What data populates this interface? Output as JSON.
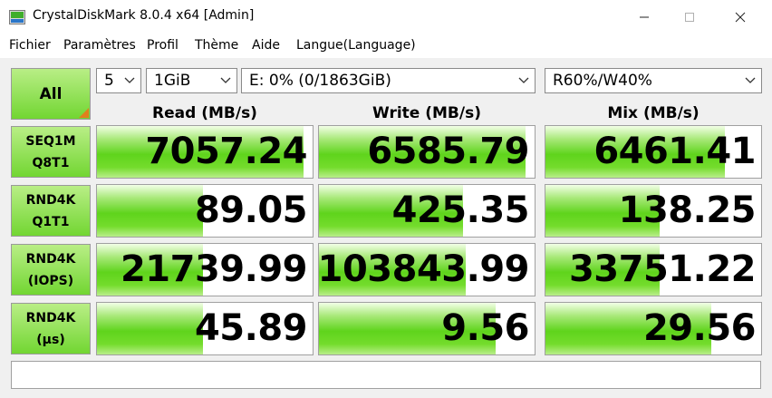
{
  "window": {
    "title": "CrystalDiskMark 8.0.4 x64 [Admin]",
    "controls": {
      "minimize": "minimize-icon",
      "maximize": "maximize-icon",
      "close": "close-icon"
    }
  },
  "menu": [
    "Fichier",
    "Paramètres",
    "Profil",
    "Thème",
    "Aide",
    "Langue(Language)"
  ],
  "toolbar": {
    "all_label": "All",
    "count": "5",
    "size": "1GiB",
    "drive": "E: 0% (0/1863GiB)",
    "mix": "R60%/W40%"
  },
  "headers": [
    "Read (MB/s)",
    "Write (MB/s)",
    "Mix (MB/s)"
  ],
  "rows": [
    {
      "line1": "SEQ1M",
      "line2": "Q8T1",
      "cells": [
        {
          "value": "7057.24",
          "level": 0.96
        },
        {
          "value": "6585.79",
          "level": 0.96
        },
        {
          "value": "6461.41",
          "level": 0.83
        }
      ]
    },
    {
      "line1": "RND4K",
      "line2": "Q1T1",
      "cells": [
        {
          "value": "89.05",
          "level": 0.49
        },
        {
          "value": "425.35",
          "level": 0.67
        },
        {
          "value": "138.25",
          "level": 0.53
        }
      ]
    },
    {
      "line1": "RND4K",
      "line2": "(IOPS)",
      "cells": [
        {
          "value": "21739.99",
          "level": 0.49
        },
        {
          "value": "103843.99",
          "level": 0.68
        },
        {
          "value": "33751.22",
          "level": 0.53
        }
      ]
    },
    {
      "line1": "RND4K",
      "line2": "(μs)",
      "cells": [
        {
          "value": "45.89",
          "level": 0.49
        },
        {
          "value": "9.56",
          "level": 0.82
        },
        {
          "value": "29.56",
          "level": 0.77
        }
      ]
    }
  ],
  "comment": "",
  "colors": {
    "accent_green": "#5fd41c",
    "corner_orange": "#e07f1e"
  }
}
